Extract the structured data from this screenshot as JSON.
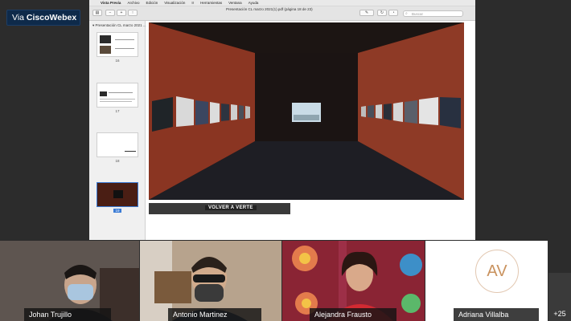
{
  "app": {
    "badge_prefix": "Via",
    "badge_brand": "Cisco",
    "badge_product": "Webex"
  },
  "shared_screen": {
    "menubar": [
      "Vista Previa",
      "Archivo",
      "Edición",
      "Visualización",
      "Ir",
      "Herramientas",
      "Ventana",
      "Ayuda"
    ],
    "document_title": "Presentación CL marzo 2021(1).pdf (página 18 de 23)",
    "search_placeholder": "Buscar",
    "sidebar_title": "Presentación CL marzo 2021 ...",
    "thumbnails": [
      {
        "page": "16"
      },
      {
        "page": "17"
      },
      {
        "page": "18"
      },
      {
        "page": "19"
      }
    ],
    "slide_strip_text": "VOLVER A VERTE"
  },
  "participants": [
    {
      "name": "Johan Trujillo"
    },
    {
      "name": "Antonio Martinez"
    },
    {
      "name": "Alejandra Frausto"
    },
    {
      "name": "Adriana Villalba",
      "initials": "AV"
    }
  ],
  "overflow_count": "+25",
  "colors": {
    "badge_bg": "#0e2a4a",
    "gallery_wall": "#8e3a26",
    "avatar_text": "#c9925e"
  }
}
